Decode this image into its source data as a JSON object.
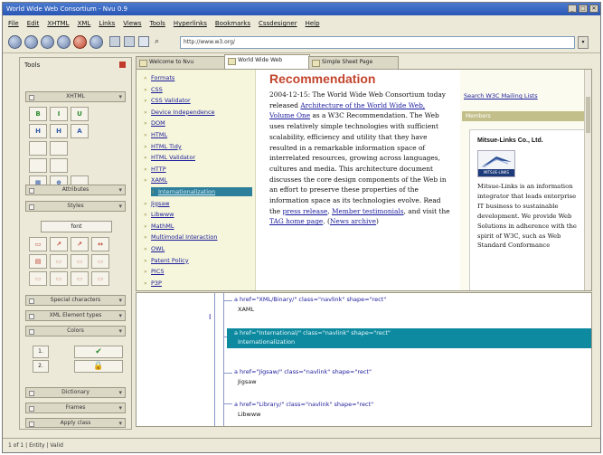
{
  "window": {
    "title": "World Wide Web Consortium - Nvu 0.9",
    "controls": [
      "_",
      "□",
      "✕"
    ]
  },
  "menu": [
    "File",
    "Edit",
    "XHTML",
    "XML",
    "Links",
    "Views",
    "Tools",
    "Hyperlinks",
    "Bookmarks",
    "Cssdesigner",
    "Help"
  ],
  "toolbar": {
    "url": "http://www.w3.org/",
    "go_label": "▾",
    "icons": [
      "back-icon",
      "forward-icon",
      "reload-icon",
      "stop-icon",
      "home-icon",
      "bookmark-icon",
      "history-icon",
      "search-icon"
    ]
  },
  "tools_panel": {
    "title": "Tools",
    "sections": {
      "xhtml": "XHTML",
      "attributes": "Attributes",
      "styles": "Styles",
      "special_chars": "Special characters",
      "xml_element_types": "XML Element types",
      "colors": "Colors",
      "dictionary": "Dictionary",
      "frames": "Frames",
      "apply_class": "Apply class"
    },
    "xhtml_buttons": [
      "B",
      "I",
      "U",
      "",
      "H",
      "H",
      "A",
      "",
      "",
      "",
      "",
      "",
      "",
      "",
      "",
      "",
      "▦",
      "⊕",
      "",
      ""
    ],
    "style_button": "font",
    "style_grid": [
      "▭",
      "↗",
      "↗",
      "↔",
      "▤",
      "▭",
      "▭",
      "▭",
      "▭",
      "▭",
      "▭",
      "▭"
    ],
    "check_label": "✔",
    "lock_label": "🔒",
    "list_labels": [
      "1.",
      "2."
    ]
  },
  "status": {
    "text": "1 of 1 | Entity | Valid"
  },
  "tabs": [
    {
      "label": "Welcome to Nvu"
    },
    {
      "label": "World Wide Web"
    },
    {
      "label": "Simple Sheet Page"
    }
  ],
  "browser": {
    "left_nav": [
      "Formats",
      "CSS",
      "CSS Validator",
      "Device Independence",
      "DOM",
      "HTML",
      "HTML Tidy",
      "HTML Validator",
      "HTTP",
      "XAML",
      "Internationalization",
      "Jigsaw",
      "Libwww",
      "MathML",
      "Multimodal Interaction",
      "OWL",
      "Patent Policy",
      "PICS",
      "P3P"
    ],
    "selected_index": 10,
    "headline": "Recommendation",
    "body_parts": {
      "p1": "2004-12-15: The World Wide Web Consortium today released ",
      "link1": "Architecture of the World Wide Web, Volume One",
      "p2": " as a W3C Recommendation. The Web uses relatively simple technologies with sufficient scalability, efficiency and utility that they have resulted in a remarkable information space of interrelated resources, growing across languages, cultures and media. This architecture document discusses the core design components of the Web in an effort to preserve these properties of the information space as its technologies evolve. Read the ",
      "link2": "press release",
      "p3": ", ",
      "link3": "Member testimonials",
      "p4": ", and visit the ",
      "link4": "TAG home page",
      "p5": ". (",
      "link5": "News archive",
      "p6": ")"
    },
    "right": {
      "search_link": "Search W3C Mailing Lists",
      "bar_label": "Members",
      "sponsor_title": "Mitsue-Links Co., Ltd.",
      "logo_caption": "MITSUE-LINKS",
      "sponsor_text": "Mitsue-Links is an information integrator that leads enterprise IT business to sustainable development. We provide Web Solutions in adherence with the spirit of W3C, such as Web Standard Conformance"
    }
  },
  "source": {
    "lines": [
      {
        "tag": "a href=\"XML/Binary/\" class=\"navlink\" shape=\"rect\"",
        "text": "XAML",
        "selected": false
      },
      {
        "tag": "a href=\"International/\" class=\"navlink\" shape=\"rect\"",
        "text": "Internationalization",
        "selected": true
      },
      {
        "tag": "a href=\"Jigsaw/\" class=\"navlink\" shape=\"rect\"",
        "text": "Jigsaw",
        "selected": false
      },
      {
        "tag": "a href=\"Library/\" class=\"navlink\" shape=\"rect\"",
        "text": "Libwww",
        "selected": false
      }
    ]
  }
}
